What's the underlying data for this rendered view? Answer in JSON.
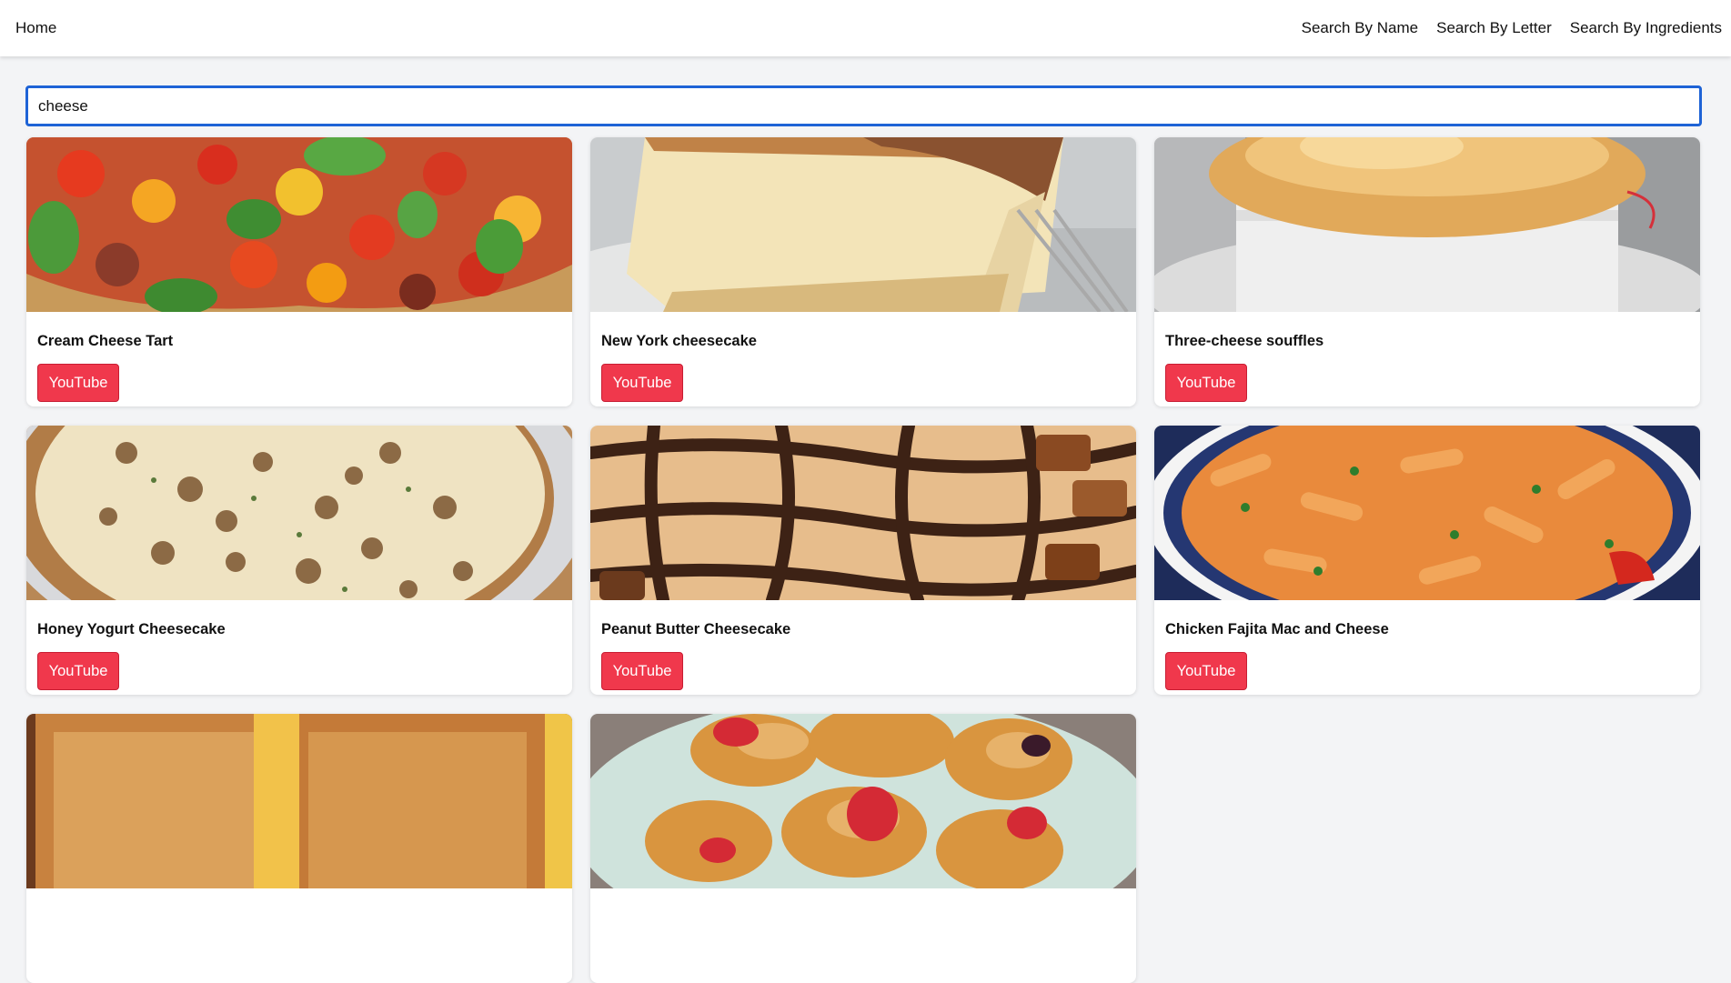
{
  "nav": {
    "home": "Home",
    "search_by_name": "Search By Name",
    "search_by_letter": "Search By Letter",
    "search_by_ingredients": "Search By Ingredients"
  },
  "search": {
    "value": "cheese"
  },
  "colors": {
    "accent": "#1e63d6",
    "youtube_button": "#f0384c"
  },
  "meals": [
    {
      "name": "Cream Cheese Tart",
      "button": "YouTube",
      "image": "tomato-tart-photo"
    },
    {
      "name": "New York cheesecake",
      "button": "YouTube",
      "image": "cheesecake-slice-photo"
    },
    {
      "name": "Three-cheese souffles",
      "button": "YouTube",
      "image": "souffle-photo"
    },
    {
      "name": "Honey Yogurt Cheesecake",
      "button": "YouTube",
      "image": "walnut-cheesecake-photo"
    },
    {
      "name": "Peanut Butter Cheesecake",
      "button": "YouTube",
      "image": "chocolate-drizzle-photo"
    },
    {
      "name": "Chicken Fajita Mac and Cheese",
      "button": "YouTube",
      "image": "pasta-photo"
    },
    {
      "name": "",
      "button": "",
      "image": "grilled-cheese-photo"
    },
    {
      "name": "",
      "button": "",
      "image": "strawberry-pastry-photo"
    }
  ]
}
